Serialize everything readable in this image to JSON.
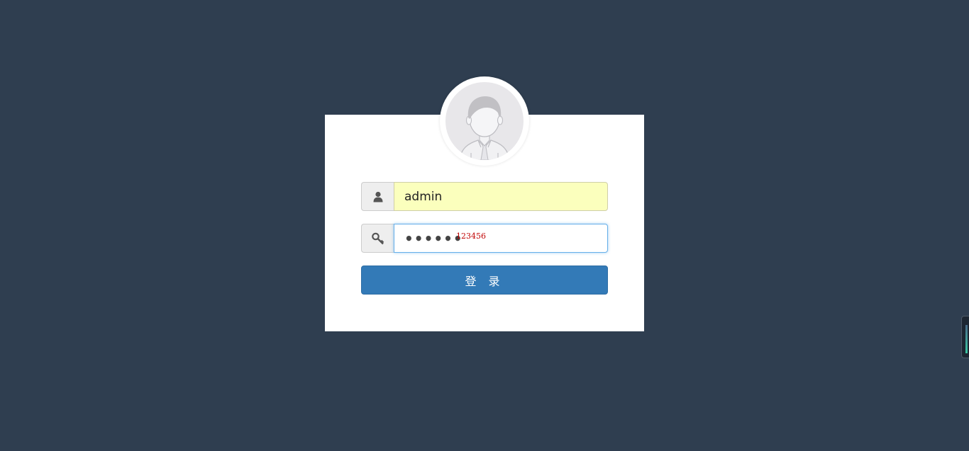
{
  "login": {
    "username_value": "admin",
    "password_value": "123456",
    "password_hint": "123456",
    "submit_label": "登 录"
  },
  "icons": {
    "user": "user-icon",
    "key": "key-icon",
    "avatar": "default-avatar"
  },
  "colors": {
    "page_background": "#2f3e50",
    "panel_background": "#ffffff",
    "username_field": "#fbffbd",
    "primary_button": "#337ab7",
    "focus_border": "#66afe9",
    "hint_text": "#c00000"
  }
}
